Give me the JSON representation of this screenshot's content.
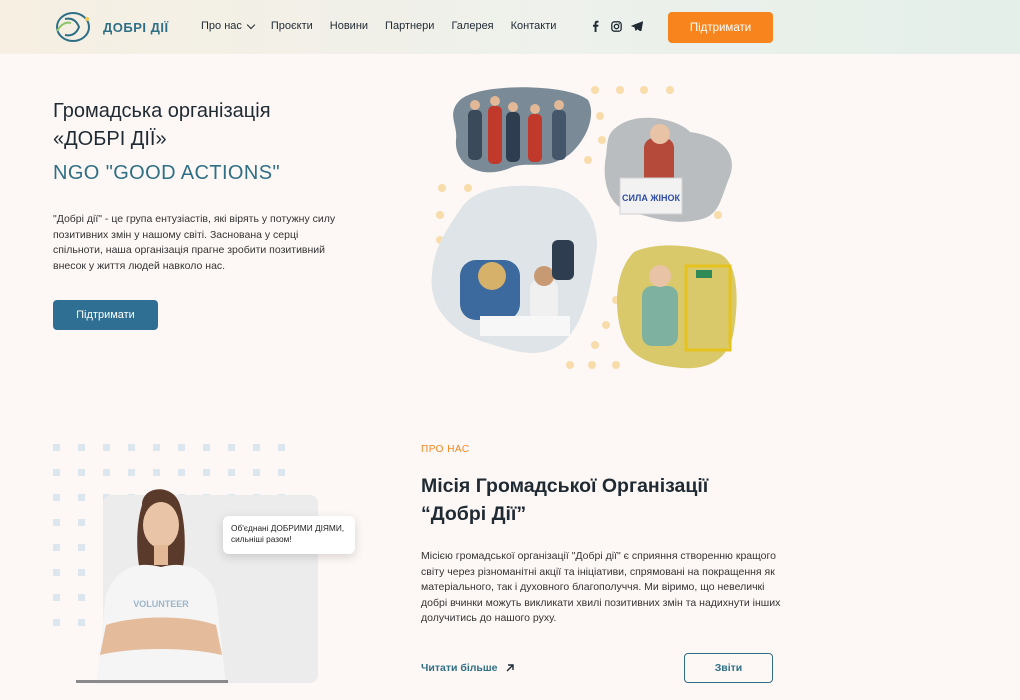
{
  "brand": {
    "name": "ДОБРІ ДІЇ",
    "accent": "#2f6f86",
    "cta_color": "#f7841d"
  },
  "nav": {
    "items": [
      {
        "label": "Про нас",
        "has_dropdown": true
      },
      {
        "label": "Проєкти"
      },
      {
        "label": "Новини"
      },
      {
        "label": "Партнери"
      },
      {
        "label": "Галерея"
      },
      {
        "label": "Контакти"
      }
    ],
    "socials": [
      "facebook-icon",
      "instagram-icon",
      "telegram-icon"
    ],
    "cta_label": "Підтримати"
  },
  "hero": {
    "title_line1": "Громадська організація",
    "title_line2": "«ДОБРІ ДІЇ»",
    "subtitle": "NGO \"GOOD ACTIONS\"",
    "description": "\"Добрі дії\" - це група ентузіастів, які вірять у потужну силу позитивних змін у нашому світі. Заснована у серці спільноти, наша організація прагне зробити позитивний внесок у життя людей навколо нас.",
    "button_label": "Підтримати",
    "photo_sign_text": "СИЛА ЖІНОК"
  },
  "about": {
    "eyebrow": "ПРО НАС",
    "title_line1": "Місія Громадської Організації",
    "title_line2": "“Добрі Дії”",
    "description": "Місією громадської організації \"Добрі дії\" є сприяння створенню кращого світу через різноманітні акції та ініціативи, спрямовані на покращення як матеріального, так і духовного благополуччя. Ми віримо, що невеличкі добрі вчинки можуть викликати хвилі позитивних змін та надихнути інших долучитись до нашого руху.",
    "bubble_line1": "Об'єднані ДОБРИМИ ДІЯМИ,",
    "bubble_line2": "сильніші разом!",
    "shirt_text": "VOLUNTEER",
    "read_more_label": "Читати більше",
    "reports_label": "Звіти"
  }
}
